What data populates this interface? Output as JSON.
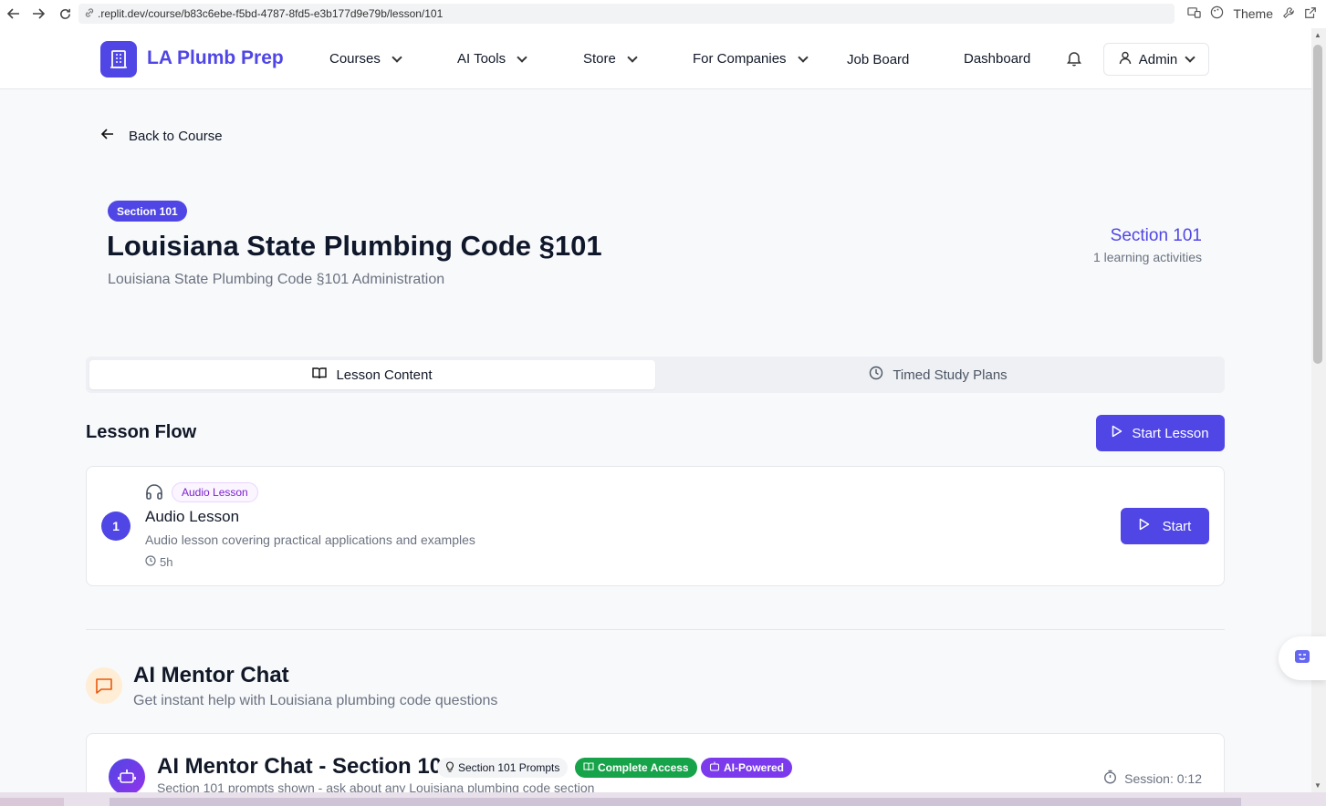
{
  "browser": {
    "url": ".replit.dev/course/b83c6ebe-f5bd-4787-8fd5-e3b177d9e79b/lesson/101",
    "theme_label": "Theme"
  },
  "header": {
    "brand": "LA Plumb Prep",
    "nav": {
      "courses": "Courses",
      "ai_tools": "AI Tools",
      "store": "Store",
      "for_companies": "For Companies",
      "job_board": "Job Board",
      "dashboard": "Dashboard"
    },
    "user_label": "Admin"
  },
  "page": {
    "back_label": "Back to Course",
    "section_badge": "Section 101",
    "title": "Louisiana State Plumbing Code §101",
    "subtitle": "Louisiana State Plumbing Code §101 Administration",
    "side_section": "Section 101",
    "side_activities": "1 learning activities"
  },
  "tabs": {
    "lesson_content": "Lesson Content",
    "timed_study_plans": "Timed Study Plans"
  },
  "lesson_flow": {
    "title": "Lesson Flow",
    "start_lesson_label": "Start Lesson",
    "items": [
      {
        "step": "1",
        "badge": "Audio Lesson",
        "name": "Audio Lesson",
        "description": "Audio lesson covering practical applications and examples",
        "duration": "5h",
        "start_label": "Start"
      }
    ]
  },
  "mentor": {
    "title": "AI Mentor Chat",
    "subtitle": "Get instant help with Louisiana plumbing code questions",
    "chat_title": "AI Mentor Chat - Section 101",
    "chip_prompts": "Section 101 Prompts",
    "chip_access": "Complete Access",
    "chip_ai": "AI-Powered",
    "chat_subtitle": "Section 101 prompts shown - ask about any Louisiana plumbing code section",
    "session": "Session: 0:12"
  },
  "colors": {
    "brand": "#4f46e5",
    "access_green": "#16a34a",
    "ai_purple": "#7c3aed",
    "mentor_orange_bg": "#ffedd5"
  }
}
